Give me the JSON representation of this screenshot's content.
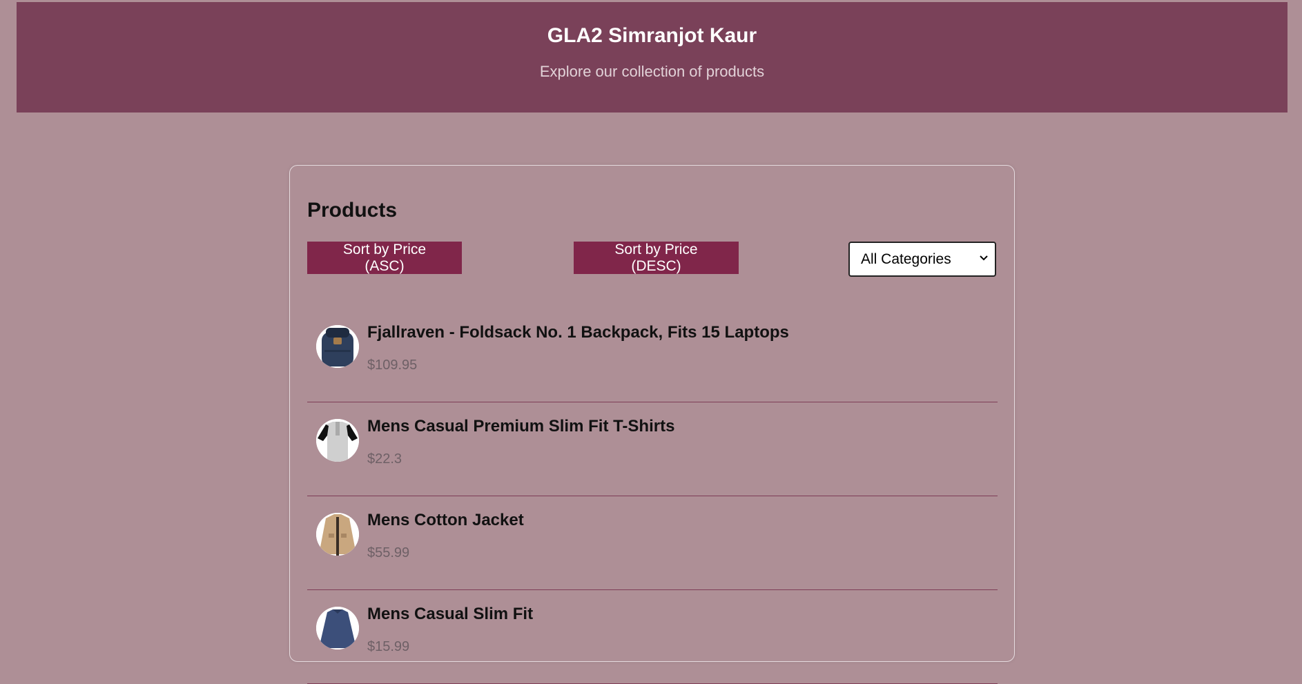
{
  "header": {
    "title": "GLA2 Simranjot Kaur",
    "subtitle": "Explore our collection of products"
  },
  "products_section": {
    "heading": "Products",
    "sort_asc_label": "Sort by Price (ASC)",
    "sort_desc_label": "Sort by Price (DESC)",
    "category_select_value": "All Categories"
  },
  "products": [
    {
      "name": "Fjallraven - Foldsack No. 1 Backpack, Fits 15 Laptops",
      "price": "$109.95",
      "image": "backpack-image"
    },
    {
      "name": "Mens Casual Premium Slim Fit T-Shirts",
      "price": "$22.3",
      "image": "tshirt-image"
    },
    {
      "name": "Mens Cotton Jacket",
      "price": "$55.99",
      "image": "jacket-image"
    },
    {
      "name": "Mens Casual Slim Fit",
      "price": "$15.99",
      "image": "longsleeve-image"
    }
  ],
  "colors": {
    "header_bg": "#7a4159",
    "page_bg": "#ae8f96",
    "button_bg": "#80264a"
  }
}
